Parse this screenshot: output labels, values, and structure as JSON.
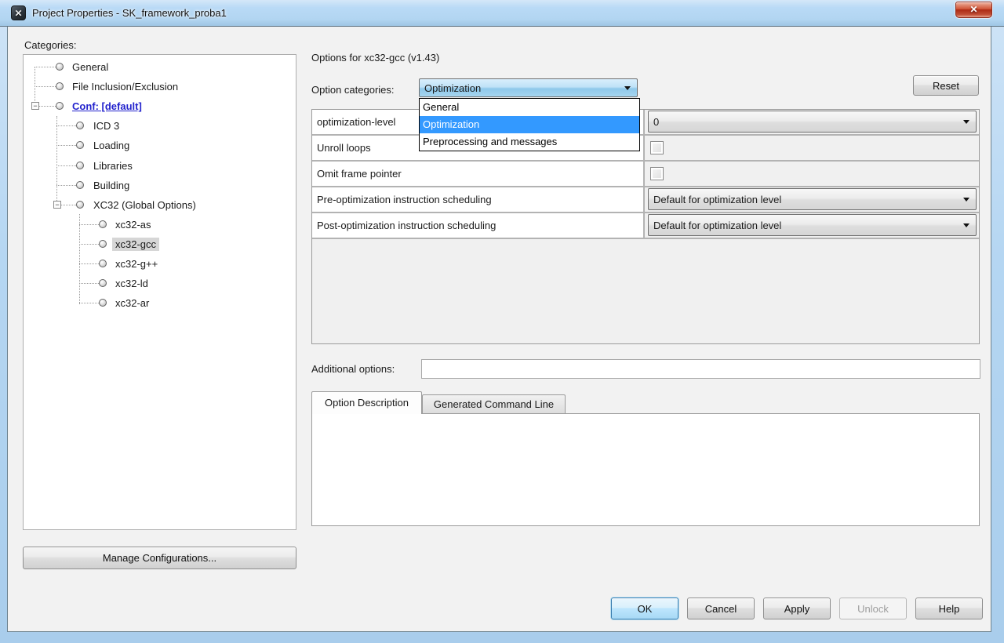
{
  "window": {
    "title": "Project Properties - SK_framework_proba1",
    "close_glyph": "✕",
    "app_icon_glyph": "✕"
  },
  "sidebar": {
    "categories_label": "Categories:",
    "tree": [
      {
        "label": "General",
        "level": 0
      },
      {
        "label": "File Inclusion/Exclusion",
        "level": 0
      },
      {
        "label": "Conf: [default]",
        "level": 0,
        "expand": true,
        "link": true
      },
      {
        "label": "ICD 3",
        "level": 1
      },
      {
        "label": "Loading",
        "level": 1
      },
      {
        "label": "Libraries",
        "level": 1
      },
      {
        "label": "Building",
        "level": 1
      },
      {
        "label": "XC32 (Global Options)",
        "level": 1,
        "expand": true
      },
      {
        "label": "xc32-as",
        "level": 2
      },
      {
        "label": "xc32-gcc",
        "level": 2,
        "selected": true
      },
      {
        "label": "xc32-g++",
        "level": 2
      },
      {
        "label": "xc32-ld",
        "level": 2
      },
      {
        "label": "xc32-ar",
        "level": 2
      }
    ],
    "manage_button_label": "Manage Configurations..."
  },
  "options_panel": {
    "heading": "Options for xc32-gcc (v1.43)",
    "category_label": "Option categories:",
    "category_selected_value": "Optimization",
    "reset_button_label": "Reset",
    "category_dropdown": {
      "open": true,
      "options": [
        "General",
        "Optimization",
        "Preprocessing and messages"
      ],
      "selected": "Optimization"
    },
    "option_rows": [
      {
        "label": "optimization-level",
        "control": "select",
        "value": "0"
      },
      {
        "label": "Unroll loops",
        "control": "checkbox",
        "checked": false
      },
      {
        "label": "Omit frame pointer",
        "control": "checkbox",
        "checked": false
      },
      {
        "label": "Pre-optimization instruction scheduling",
        "control": "select",
        "value": "Default for optimization level"
      },
      {
        "label": "Post-optimization instruction scheduling",
        "control": "select",
        "value": "Default for optimization level"
      }
    ],
    "additional_options_label": "Additional options:",
    "additional_options_value": "",
    "tabs": [
      {
        "label": "Option Description",
        "active": true
      },
      {
        "label": "Generated Command Line",
        "active": false
      }
    ],
    "description_text": ""
  },
  "footer": {
    "buttons": [
      {
        "label": "OK",
        "style": "default"
      },
      {
        "label": "Cancel",
        "style": "normal"
      },
      {
        "label": "Apply",
        "style": "normal"
      },
      {
        "label": "Unlock",
        "style": "disabled"
      },
      {
        "label": "Help",
        "style": "normal"
      }
    ]
  },
  "colors": {
    "titlebar_blue": "#b5d6f2",
    "close_red": "#c14f36",
    "selection_blue": "#3399ff",
    "link_blue": "#2323cd",
    "dialog_bg": "#f2f2f2",
    "tree_selected_bg": "#d6d6d6"
  }
}
